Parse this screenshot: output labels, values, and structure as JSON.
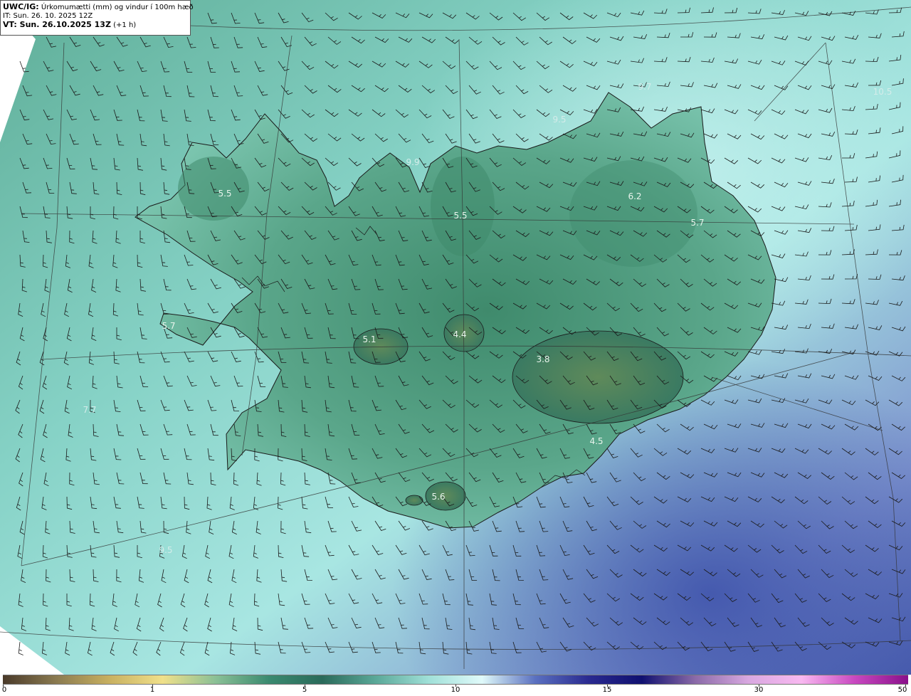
{
  "header": {
    "model_label": "UWC/IG:",
    "title": "Úrkomumætti (mm) og vindur í 100m hæð",
    "issue_time": "IT: Sun. 26. 10. 2025 12Z",
    "valid_label": "VT: Sun. 26.10.2025 13Z",
    "valid_offset": "(+1 h)"
  },
  "map_labels": [
    {
      "text": "5.5",
      "region": "westfjords"
    },
    {
      "text": "5.5",
      "region": "north-central"
    },
    {
      "text": "6.2",
      "region": "northeast"
    },
    {
      "text": "5.7",
      "region": "east"
    },
    {
      "text": "9.9",
      "region": "north-coast"
    },
    {
      "text": "9.5",
      "region": "north-sea"
    },
    {
      "text": "9.7",
      "region": "northeast-sea"
    },
    {
      "text": "10.5",
      "region": "far-northeast-sea"
    },
    {
      "text": "5.7",
      "region": "snaefellsnes"
    },
    {
      "text": "5.1",
      "region": "langjokull"
    },
    {
      "text": "4.4",
      "region": "hofsjokull"
    },
    {
      "text": "3.8",
      "region": "vatnajokull"
    },
    {
      "text": "4.5",
      "region": "southeast"
    },
    {
      "text": "5.6",
      "region": "myrdalsjokull"
    },
    {
      "text": "7.7",
      "region": "west-sea"
    },
    {
      "text": "9.5",
      "region": "southwest-sea"
    }
  ],
  "colorbar": {
    "ticks": [
      "0",
      "1",
      "5",
      "10",
      "15",
      "30",
      "50"
    ],
    "stops": [
      "#4a3a2a",
      "#8a7a50",
      "#c8b060",
      "#f0e08a",
      "#8ac096",
      "#3a8a70",
      "#2a6a5a",
      "#5aa898",
      "#a0e0d8",
      "#e0fafa",
      "#5a70c0",
      "#2a2a90",
      "#101070",
      "#8a6aa8",
      "#d8a8e0",
      "#f8b8f0",
      "#c848c0",
      "#8a108a"
    ]
  },
  "colors": {
    "land_dark": "#3d8a6e",
    "sea_base": "#7ccfc2",
    "sea_light": "#b6ecea",
    "sea_blue": "#6e86c8",
    "coast": "#1a1a1a"
  }
}
